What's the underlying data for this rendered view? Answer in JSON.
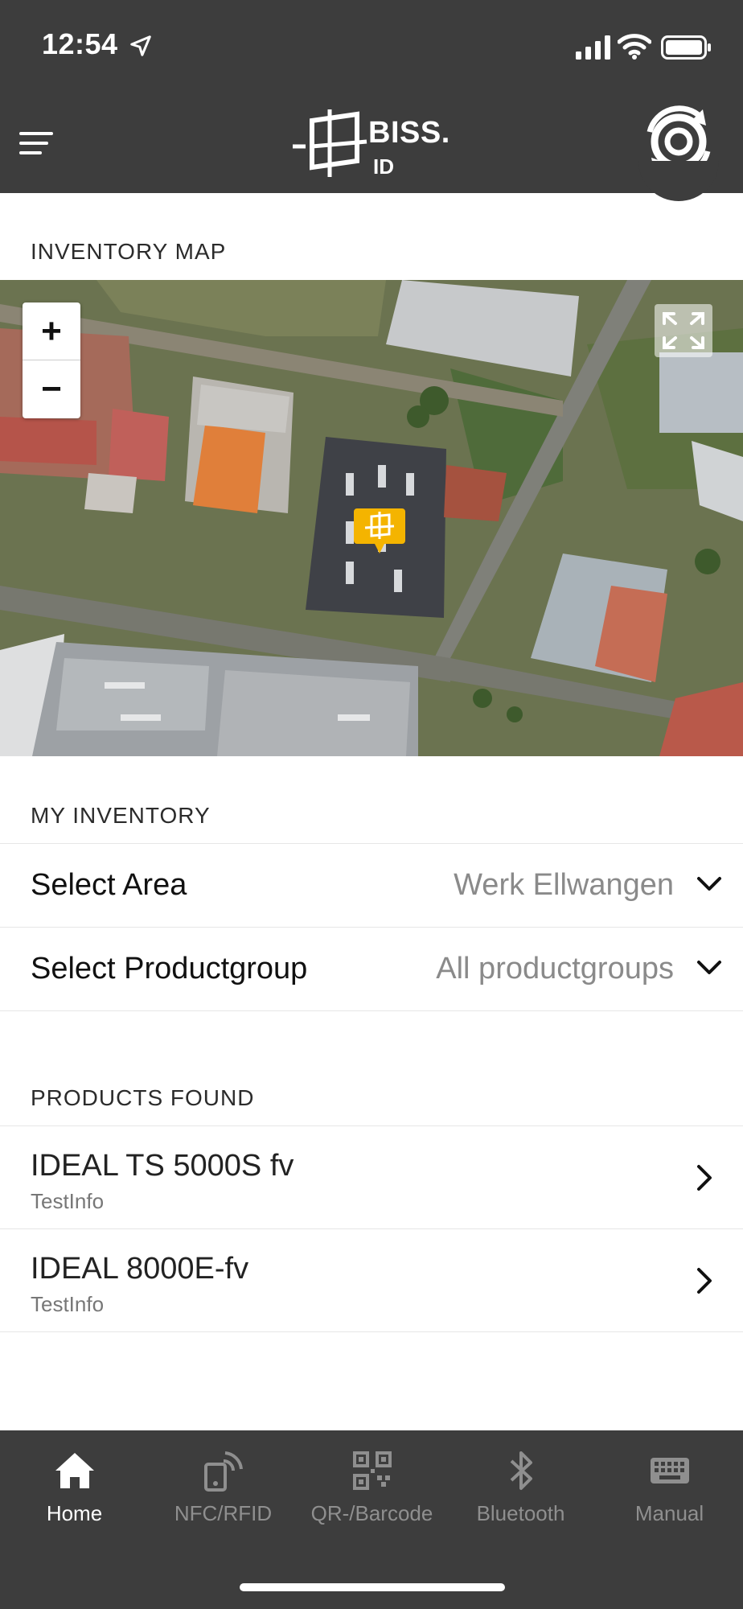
{
  "status_bar": {
    "time": "12:54"
  },
  "header": {
    "logo_text": "BISS.",
    "logo_subtext": "ID",
    "menu_icon": "hamburger-icon",
    "scan_icon": "scan-rotate-icon"
  },
  "inventory_map": {
    "title": "INVENTORY MAP",
    "zoom_in_label": "+",
    "zoom_out_label": "−",
    "fullscreen_icon": "fullscreen-icon",
    "marker_icon": "bissid-marker-icon"
  },
  "my_inventory": {
    "title": "MY INVENTORY",
    "filters": [
      {
        "label": "Select Area",
        "value": "Werk Ellwangen"
      },
      {
        "label": "Select Productgroup",
        "value": "All productgroups"
      }
    ]
  },
  "products_found": {
    "title": "PRODUCTS FOUND",
    "items": [
      {
        "name": "IDEAL TS 5000S fv",
        "info": "TestInfo"
      },
      {
        "name": "IDEAL 8000E-fv",
        "info": "TestInfo"
      }
    ]
  },
  "tab_bar": {
    "tabs": [
      {
        "label": "Home",
        "icon": "home-icon",
        "active": true
      },
      {
        "label": "NFC/RFID",
        "icon": "nfc-icon",
        "active": false
      },
      {
        "label": "QR-/Barcode",
        "icon": "qr-code-icon",
        "active": false
      },
      {
        "label": "Bluetooth",
        "icon": "bluetooth-icon",
        "active": false
      },
      {
        "label": "Manual",
        "icon": "keyboard-icon",
        "active": false
      }
    ]
  },
  "colors": {
    "header_bg": "#3d3d3d",
    "marker": "#f4b400",
    "secondary_text": "#8a8a8a"
  }
}
